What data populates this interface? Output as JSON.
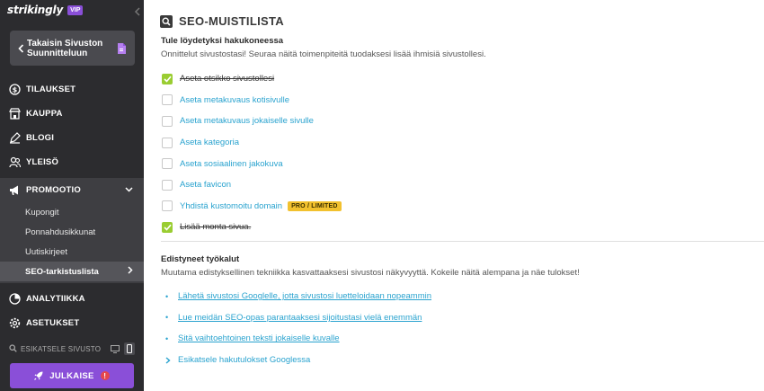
{
  "sidebar": {
    "brand": "strikingly",
    "badge": "VIP",
    "back_label_1": "Takaisin Sivuston",
    "back_label_2": "Suunnitteluun",
    "nav": {
      "orders": "TILAUKSET",
      "shop": "KAUPPA",
      "blog": "BLOGI",
      "audience": "YLEISÖ",
      "promotion": "PROMOOTIO",
      "analytics": "ANALYTIIKKA",
      "settings": "ASETUKSET"
    },
    "promotion_items": [
      "Kupongit",
      "Ponnahdusikkunat",
      "Uutiskirjeet",
      "SEO-tarkistuslista"
    ],
    "preview_label": "ESIKATSELE SIVUSTO",
    "publish_label": "JULKAISE",
    "publish_warning": "!"
  },
  "main": {
    "title": "SEO-MUISTILISTA",
    "section1": {
      "title": "Tule löydetyksi hakukoneessa",
      "desc": "Onnittelut sivustostasi! Seuraa näitä toimenpiteitä tuodaksesi lisää ihmisiä sivustollesi."
    },
    "checklist": [
      {
        "label": "Aseta otsikko sivustollesi",
        "done": true
      },
      {
        "label": "Aseta metakuvaus kotisivulle",
        "done": false
      },
      {
        "label": "Aseta metakuvaus jokaiselle sivulle",
        "done": false
      },
      {
        "label": "Aseta kategoria",
        "done": false
      },
      {
        "label": "Aseta sosiaalinen jakokuva",
        "done": false
      },
      {
        "label": "Aseta favicon",
        "done": false
      },
      {
        "label": "Yhdistä kustomoitu domain",
        "done": false
      },
      {
        "label": "Lisää monta sivua.",
        "done": true
      }
    ],
    "pro_badge": "PRO / LIMITED",
    "section2": {
      "title": "Edistyneet työkalut",
      "desc": "Muutama edistyksellinen tekniikka kasvattaaksesi sivustosi näkyvyyttä. Kokeile näitä alempana ja näe tulokset!"
    },
    "links": [
      "Lähetä sivustosi Googlelle, jotta sivustosi luetteloidaan nopeammin",
      "Lue meidän SEO-opas parantaaksesi sijoitustasi vielä enemmän",
      "Sitä vaihtoehtoinen teksti jokaiselle kuvalle"
    ],
    "expand_label": "Esikatsele hakutulokset Googlessa"
  },
  "colors": {
    "sidebar_bg": "#2c2c2f",
    "accent_purple": "#8a4fd8",
    "link_blue": "#2aa3cf",
    "check_green": "#9acd32",
    "pro_yellow": "#f2c12e"
  }
}
